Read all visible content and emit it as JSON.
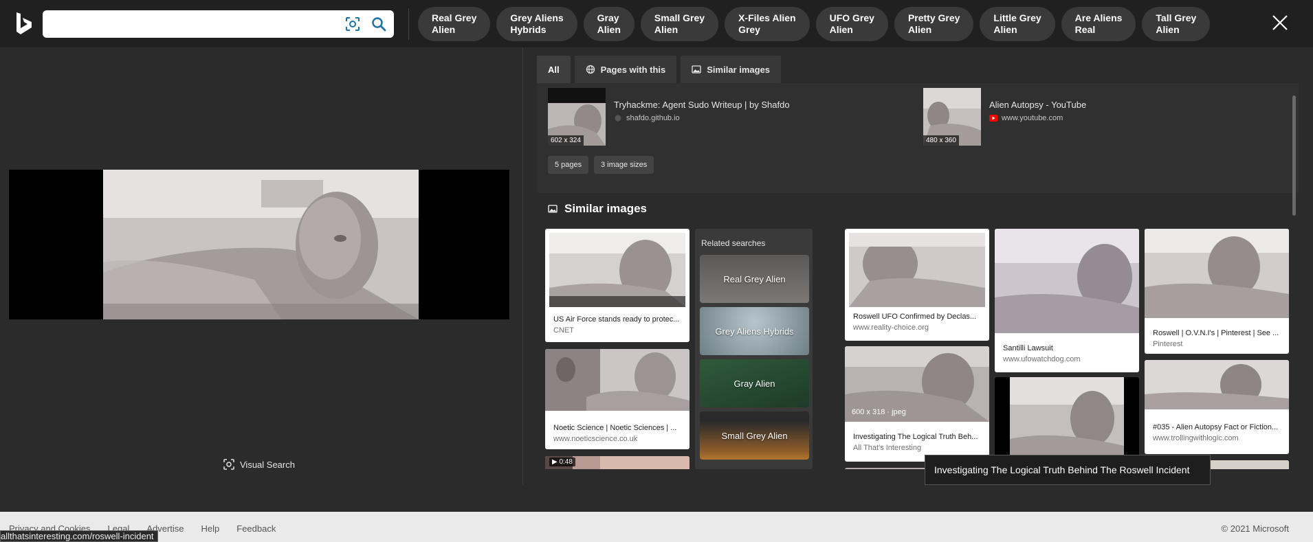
{
  "header": {
    "search_value": "",
    "chips": [
      {
        "label": "Real Grey\nAlien"
      },
      {
        "label": "Grey Aliens\nHybrids"
      },
      {
        "label": "Gray\nAlien"
      },
      {
        "label": "Small Grey\nAlien"
      },
      {
        "label": "X-Files Alien\nGrey"
      },
      {
        "label": "UFO Grey\nAlien"
      },
      {
        "label": "Pretty Grey\nAlien"
      },
      {
        "label": "Little Grey\nAlien"
      },
      {
        "label": "Are Aliens\nReal"
      },
      {
        "label": "Tall Grey\nAlien"
      }
    ]
  },
  "preview": {
    "visual_search_label": "Visual Search"
  },
  "tabs": [
    {
      "label": "All"
    },
    {
      "label": "Pages with this"
    },
    {
      "label": "Similar images"
    }
  ],
  "pages": [
    {
      "title": "Tryhackme: Agent Sudo Writeup | by Shafdo",
      "source": "shafdo.github.io",
      "dims": "602 x 324",
      "icon": "github-icon",
      "icon_color": "#555555"
    },
    {
      "title": "Alien Autopsy - YouTube",
      "source": "www.youtube.com",
      "dims": "480 x 360",
      "icon": "youtube-icon",
      "icon_color": "#ff0000"
    }
  ],
  "pills": {
    "pages_count": "5 pages",
    "image_sizes": "3 image sizes"
  },
  "similar": {
    "title": "Similar images",
    "related_title": "Related searches",
    "related": [
      {
        "label": "Real Grey Alien"
      },
      {
        "label": "Grey Aliens Hybrids"
      },
      {
        "label": "Gray Alien"
      },
      {
        "label": "Small Grey Alien"
      }
    ],
    "cards": [
      {
        "caption": "US Air Force stands ready to protec...",
        "source": "CNET"
      },
      {
        "caption": "Noetic Science | Noetic Sciences | ...",
        "source": "www.noeticscience.co.uk"
      },
      {
        "video_duration": "0:48"
      },
      {
        "caption": "Roswell UFO Confirmed by Declas...",
        "source": "www.reality-choice.org"
      },
      {
        "caption": "Investigating The Logical Truth Beh...",
        "source": "All That's Interesting",
        "badge": "600 x 318 · jpeg"
      },
      {
        "caption": "Santilli Lawsuit",
        "source": "www.ufowatchdog.com"
      },
      {
        "caption": "Roswell | O.V.N.I's | Pinterest | See ...",
        "source": "Pinterest"
      },
      {
        "caption": "#035 - Alien Autopsy Fact or Fiction...",
        "source": "www.trollingwithlogic.com"
      }
    ]
  },
  "tooltip": "Investigating The Logical Truth Behind The Roswell Incident",
  "footer": {
    "links": [
      "Privacy and Cookies",
      "Legal",
      "Advertise",
      "Help",
      "Feedback"
    ],
    "copyright": "© 2021 Microsoft"
  },
  "status_url": "allthatsinteresting.com/roswell-incident"
}
